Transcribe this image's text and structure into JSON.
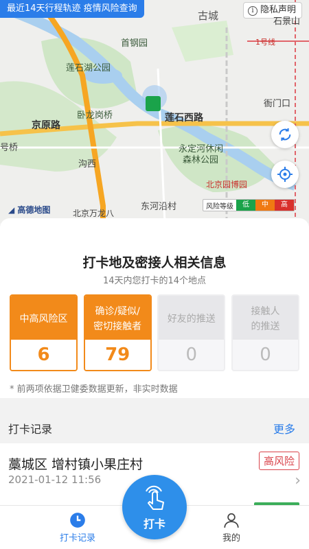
{
  "map": {
    "banner": "最近14天行程轨迹 疫情风险查询",
    "privacy_label": "隐私声明",
    "labels": {
      "gucheng": "古城",
      "shijingshan": "石景山",
      "line1": "1号线",
      "shougangyuan": "首钢园",
      "lianshihu": "莲石湖公园",
      "wolonggang": "卧龙岗桥",
      "lianshixilu": "莲石西路",
      "jingyuanlu": "京原路",
      "hengmenkou": "衙门口",
      "yongdinghe_1": "永定河休闲",
      "yongdinghe_2": "森林公园",
      "haoqiao": "号桥",
      "gouxi": "沟西",
      "bowuyuan": "北京园博园",
      "dongheyancun": "东河沿村",
      "wanlong": "北京万龙八",
      "amap": "高德地图"
    },
    "risk_legend": {
      "title": "风险等级",
      "low": "低",
      "mid": "中",
      "high": "高"
    },
    "colors": {
      "low": "#1aa34a",
      "mid": "#f07a12",
      "high": "#d9302c"
    }
  },
  "card": {
    "title": "打卡地及密接人相关信息",
    "subtitle": "14天内您打卡的14个地点",
    "tiles": [
      {
        "label_1": "中高风险区",
        "label_2": "",
        "value": "6"
      },
      {
        "label_1": "确诊/疑似/",
        "label_2": "密切接触者",
        "value": "79"
      },
      {
        "label_1": "好友的推送",
        "label_2": "",
        "value": "0"
      },
      {
        "label_1": "接触人",
        "label_2": "的推送",
        "value": "0"
      }
    ],
    "note": "* 前两项依据卫健委数据更新，非实时数据"
  },
  "records": {
    "title": "打卡记录",
    "more": "更多",
    "items": [
      {
        "place": "藁城区  增村镇小果庄村",
        "time": "2021-01-12 11:56",
        "risk": "高风险"
      }
    ]
  },
  "nav": {
    "left": "打卡记录",
    "center": "打卡",
    "right": "我的"
  }
}
